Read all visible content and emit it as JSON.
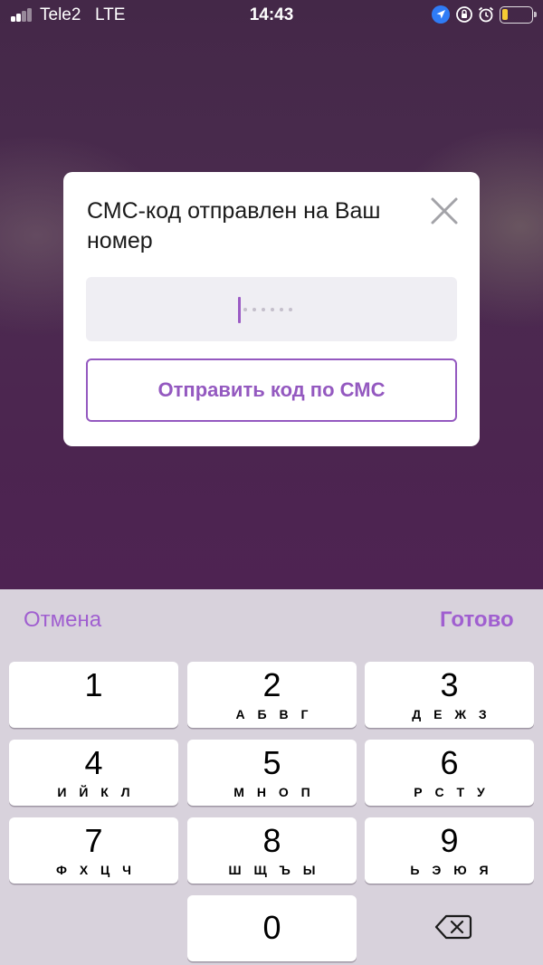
{
  "status_bar": {
    "carrier": "Tele2",
    "network": "LTE",
    "time": "14:43",
    "icons": [
      "location-arrow-icon",
      "orientation-lock-icon",
      "alarm-icon",
      "battery-icon"
    ],
    "battery_color": "#f5cc33"
  },
  "dialog": {
    "title": "СМС-код отправлен на Ваш номер",
    "close_icon": "close-icon",
    "code_placeholder": "••••••",
    "send_button_label": "Отправить код по СМС",
    "accent_color": "#9459c0"
  },
  "keyboard": {
    "cancel_label": "Отмена",
    "done_label": "Готово",
    "keys": [
      {
        "digit": "1",
        "letters": ""
      },
      {
        "digit": "2",
        "letters": "А Б В Г"
      },
      {
        "digit": "3",
        "letters": "Д Е Ж З"
      },
      {
        "digit": "4",
        "letters": "И Й К Л"
      },
      {
        "digit": "5",
        "letters": "М Н О П"
      },
      {
        "digit": "6",
        "letters": "Р С Т У"
      },
      {
        "digit": "7",
        "letters": "Ф Х Ц Ч"
      },
      {
        "digit": "8",
        "letters": "Ш Щ Ъ Ы"
      },
      {
        "digit": "9",
        "letters": "Ь Э Ю Я"
      },
      {
        "digit": "0",
        "letters": ""
      }
    ],
    "delete_icon": "backspace-icon"
  }
}
